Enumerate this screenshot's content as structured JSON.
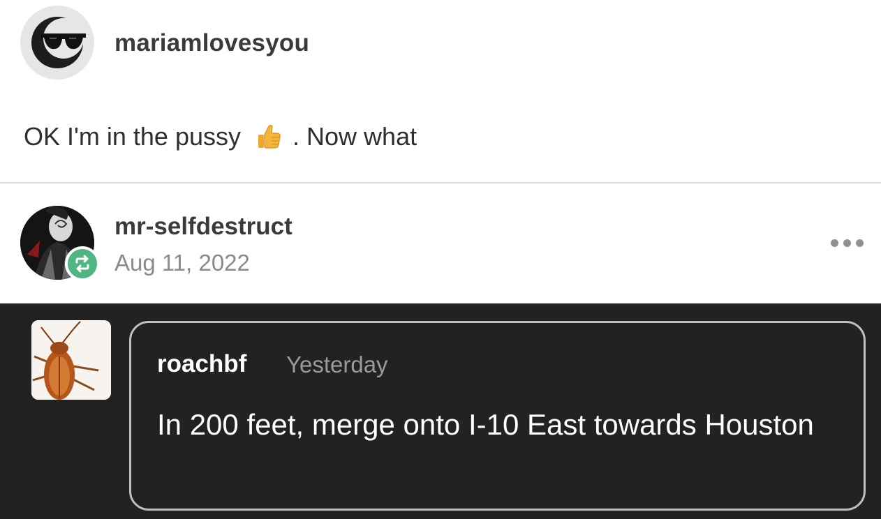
{
  "original_post": {
    "username": "mariamlovesyou",
    "avatar_icon": "sunglasses-moon-icon",
    "text_before_emoji": "OK I'm in the pussy",
    "emoji": "thumbs-up-icon",
    "text_after_emoji": ". Now what"
  },
  "reblog": {
    "username": "mr-selfdestruct",
    "date": "Aug 11, 2022",
    "badge_icon": "reblog-icon",
    "badge_color": "#4fb583",
    "menu_icon": "more-options-icon"
  },
  "comment": {
    "username": "roachbf",
    "timestamp": "Yesterday",
    "text": "In 200 feet, merge onto I-10 East towards Houston",
    "avatar_icon": "cockroach-icon",
    "background_color": "#222222"
  }
}
